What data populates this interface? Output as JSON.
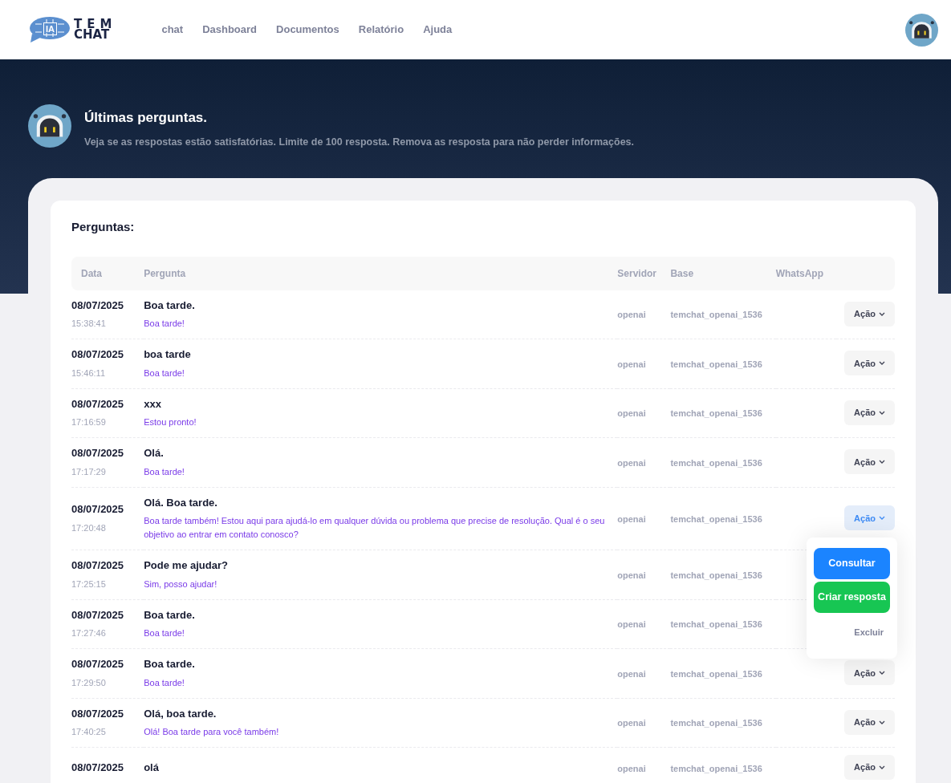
{
  "logo": {
    "badge": "IA",
    "line_1": "TEM",
    "line_2": "CHAT"
  },
  "nav": [
    {
      "label": "chat"
    },
    {
      "label": "Dashboard"
    },
    {
      "label": "Documentos"
    },
    {
      "label": "Relatório"
    },
    {
      "label": "Ajuda"
    }
  ],
  "header": {
    "title": "Últimas perguntas.",
    "subtitle": "Veja se as respostas estão satisfatórias. Limite de 100 resposta. Remova as resposta para não perder informações."
  },
  "card": {
    "title": "Perguntas:"
  },
  "table": {
    "columns": [
      "Data",
      "Pergunta",
      "Servidor",
      "Base",
      "WhatsApp"
    ],
    "rows": [
      {
        "date": "08/07/2025",
        "time": "15:38:41",
        "question": "Boa tarde.",
        "answer": "Boa tarde!",
        "server": "openai",
        "base": "temchat_openai_1536",
        "action": {
          "label": "Ação",
          "open": false
        }
      },
      {
        "date": "08/07/2025",
        "time": "15:46:11",
        "question": "boa tarde",
        "answer": "Boa tarde!",
        "server": "openai",
        "base": "temchat_openai_1536",
        "action": {
          "label": "Ação",
          "open": false
        }
      },
      {
        "date": "08/07/2025",
        "time": "17:16:59",
        "question": "xxx",
        "answer": "Estou pronto!",
        "server": "openai",
        "base": "temchat_openai_1536",
        "action": {
          "label": "Ação",
          "open": false
        }
      },
      {
        "date": "08/07/2025",
        "time": "17:17:29",
        "question": "Olá.",
        "answer": "Boa tarde!",
        "server": "openai",
        "base": "temchat_openai_1536",
        "action": {
          "label": "Ação",
          "open": false
        }
      },
      {
        "date": "08/07/2025",
        "time": "17:20:48",
        "question": "Olá. Boa tarde.",
        "answer": "Boa tarde também! Estou aqui para ajudá-lo em qualquer dúvida ou problema que precise de resolução. Qual é o seu objetivo ao entrar em contato conosco?",
        "server": "openai",
        "base": "temchat_openai_1536",
        "action": {
          "label": "Ação",
          "open": true,
          "menu": [
            {
              "label": "Consultar",
              "kind": "primary"
            },
            {
              "label": "Criar resposta",
              "kind": "success"
            },
            {
              "label": "Excluir",
              "kind": "link"
            }
          ]
        }
      },
      {
        "date": "08/07/2025",
        "time": "17:25:15",
        "question": "Pode me ajudar?",
        "answer": "Sim, posso ajudar!",
        "server": "openai",
        "base": "temchat_openai_1536"
      },
      {
        "date": "08/07/2025",
        "time": "17:27:46",
        "question": "Boa tarde.",
        "answer": "Boa tarde!",
        "server": "openai",
        "base": "temchat_openai_1536"
      },
      {
        "date": "08/07/2025",
        "time": "17:29:50",
        "question": "Boa tarde.",
        "answer": "Boa tarde!",
        "server": "openai",
        "base": "temchat_openai_1536",
        "action": {
          "label": "Ação",
          "open": false
        }
      },
      {
        "date": "08/07/2025",
        "time": "17:40:25",
        "question": "Olá, boa tarde.",
        "answer": "Olá! Boa tarde para você também!",
        "server": "openai",
        "base": "temchat_openai_1536",
        "action": {
          "label": "Ação",
          "open": false
        }
      },
      {
        "date": "08/07/2025",
        "question": "olá",
        "server": "openai",
        "base": "temchat_openai_1536",
        "action": {
          "label": "Ação",
          "open": false
        }
      }
    ]
  }
}
